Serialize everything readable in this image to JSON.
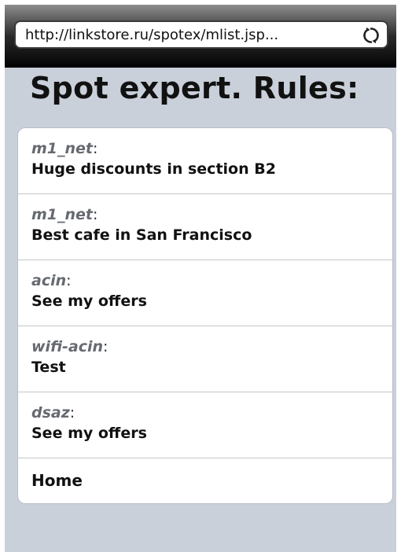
{
  "browser": {
    "url": "http://linkstore.ru/spotex/mlist.jsp..."
  },
  "page": {
    "title": "Spot expert. Rules:"
  },
  "rules": [
    {
      "author": "m1_net",
      "message": "Huge discounts in section B2"
    },
    {
      "author": "m1_net",
      "message": "Best cafe in San Francisco"
    },
    {
      "author": "acin",
      "message": "See my offers"
    },
    {
      "author": "wifi-acin",
      "message": "Test"
    },
    {
      "author": "dsaz",
      "message": "See my offers"
    }
  ],
  "separator": ":",
  "home_label": "Home",
  "icons": {
    "reload": "reload-icon"
  },
  "colors": {
    "page_background": "#c9d0da",
    "author_text": "#666a70",
    "list_background": "#ffffff"
  }
}
